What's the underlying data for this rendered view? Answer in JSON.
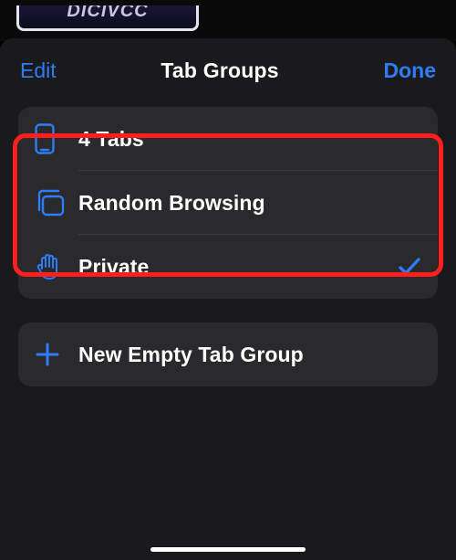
{
  "backdrop_text": "DICIVCC",
  "header": {
    "left": "Edit",
    "title": "Tab Groups",
    "right": "Done"
  },
  "groups": {
    "row0_label": "4 Tabs",
    "row1_label": "Random Browsing",
    "row2_label": "Private"
  },
  "new_group_label": "New Empty Tab Group",
  "colors": {
    "accent": "#2e7cf6"
  }
}
